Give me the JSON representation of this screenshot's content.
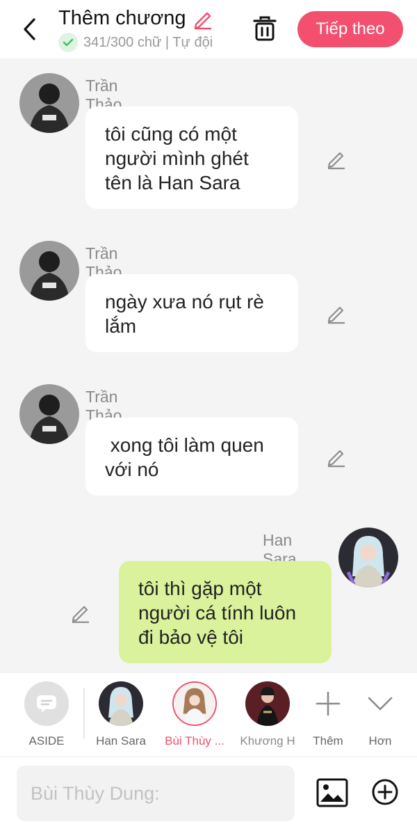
{
  "header": {
    "title": "Thêm chương",
    "sub_text": "341/300 chữ | Tự đội",
    "next_label": "Tiếp theo"
  },
  "messages": [
    {
      "sender": "Trần Thảo Linh",
      "text": "tôi cũng có một\nngười mình ghét\ntên là Han Sara",
      "side": "left"
    },
    {
      "sender": "Trần Thảo Linh",
      "text": "ngày xưa nó rụt rè\nlắm",
      "side": "left"
    },
    {
      "sender": "Trần Thảo Linh",
      "text": " xong tôi làm quen\nvới nó",
      "side": "left"
    },
    {
      "sender": "Han Sara",
      "text": "tôi thì gặp một\nngười cá tính luôn\nđi bảo vệ tôi",
      "side": "right"
    }
  ],
  "characters": [
    {
      "label": "ASIDE"
    },
    {
      "label": "Han Sara"
    },
    {
      "label": "Bùi Thùy ..."
    },
    {
      "label": "Khương H"
    },
    {
      "label": "Thêm"
    },
    {
      "label": "Hơn"
    }
  ],
  "input": {
    "placeholder": "Bùi Thùy Dung:"
  },
  "colors": {
    "accent": "#f2506e",
    "my_bubble": "#d9f29b",
    "check_green": "#3cbf5a"
  }
}
